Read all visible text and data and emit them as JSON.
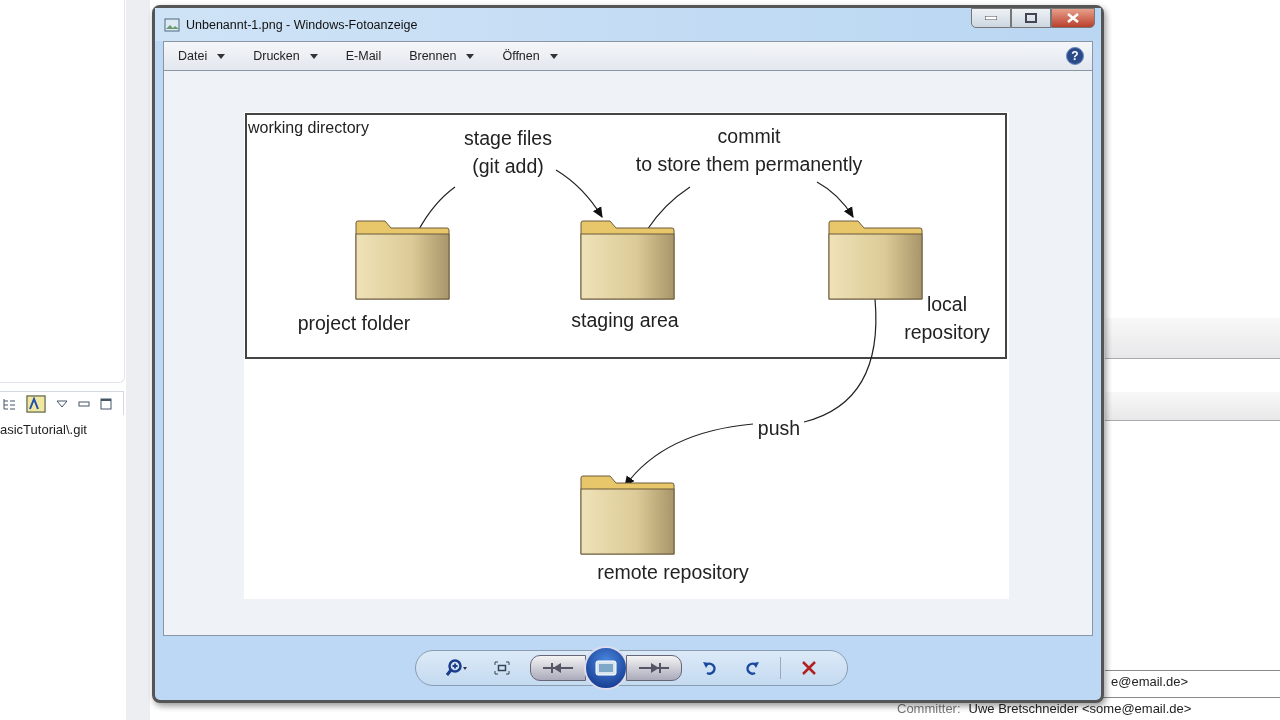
{
  "ide": {
    "tree_item": "asicTutorial\\.git",
    "author_email": "e@email.de>",
    "committer_label": "Committer:",
    "committer_value": "Uwe Bretschneider <some@email.de>"
  },
  "window": {
    "title": "Unbenannt-1.png - Windows-Fotoanzeige",
    "help_glyph": "?",
    "menu": [
      {
        "label": "Datei",
        "dropdown": true
      },
      {
        "label": "Drucken",
        "dropdown": true
      },
      {
        "label": "E-Mail",
        "dropdown": false
      },
      {
        "label": "Brennen",
        "dropdown": true
      },
      {
        "label": "Öffnen",
        "dropdown": true
      }
    ]
  },
  "diagram": {
    "frame_label": "working directory",
    "nodes": [
      {
        "lines": [
          "project folder"
        ]
      },
      {
        "lines": [
          "staging area"
        ]
      },
      {
        "lines": [
          "local",
          "repository"
        ]
      },
      {
        "lines": [
          "remote repository"
        ]
      }
    ],
    "edges": [
      {
        "lines": [
          "stage files",
          "(git add)"
        ]
      },
      {
        "lines": [
          "commit",
          "to store them permanently"
        ]
      },
      {
        "lines": [
          "push"
        ]
      }
    ]
  }
}
